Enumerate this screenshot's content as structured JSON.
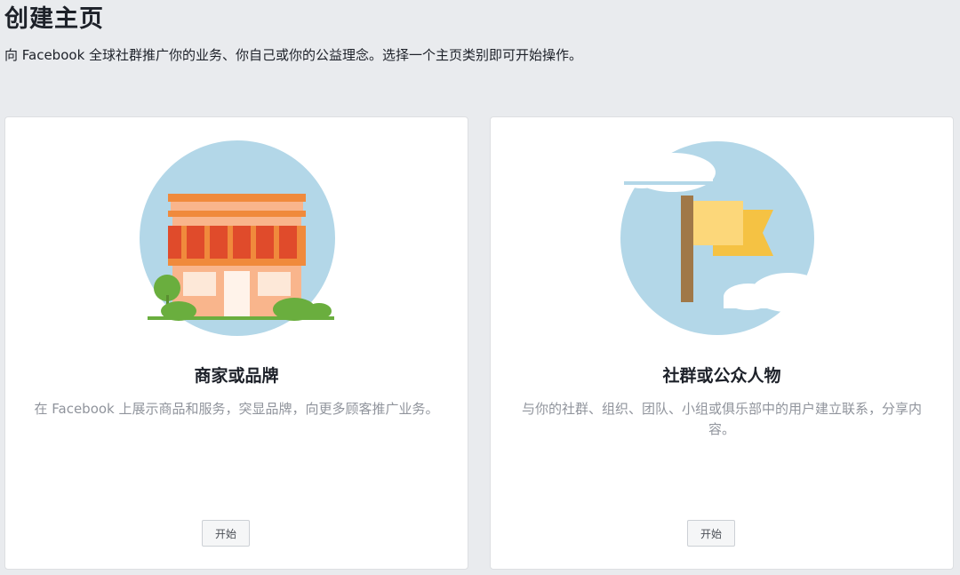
{
  "page": {
    "title": "创建主页",
    "subtitle": "向 Facebook 全球社群推广你的业务、你自己或你的公益理念。选择一个主页类别即可开始操作。"
  },
  "cards": [
    {
      "title": "商家或品牌",
      "description": "在 Facebook 上展示商品和服务，突显品牌，向更多顾客推广业务。",
      "button_label": "开始",
      "icon": "storefront-illustration"
    },
    {
      "title": "社群或公众人物",
      "description": "与你的社群、组织、团队、小组或俱乐部中的用户建立联系，分享内容。",
      "button_label": "开始",
      "icon": "flag-illustration"
    }
  ],
  "colors": {
    "background": "#e9ebee",
    "card": "#ffffff",
    "circle": "#b3d7e8",
    "awning_red": "#e04b2b",
    "roof_orange": "#f08a3c",
    "wall_peach": "#f9b58c",
    "bush_green": "#6aae3e",
    "flag_yellow": "#fcd77a",
    "flag_tail": "#f5c243",
    "pole_brown": "#a07848",
    "cloud": "#ffffff"
  }
}
